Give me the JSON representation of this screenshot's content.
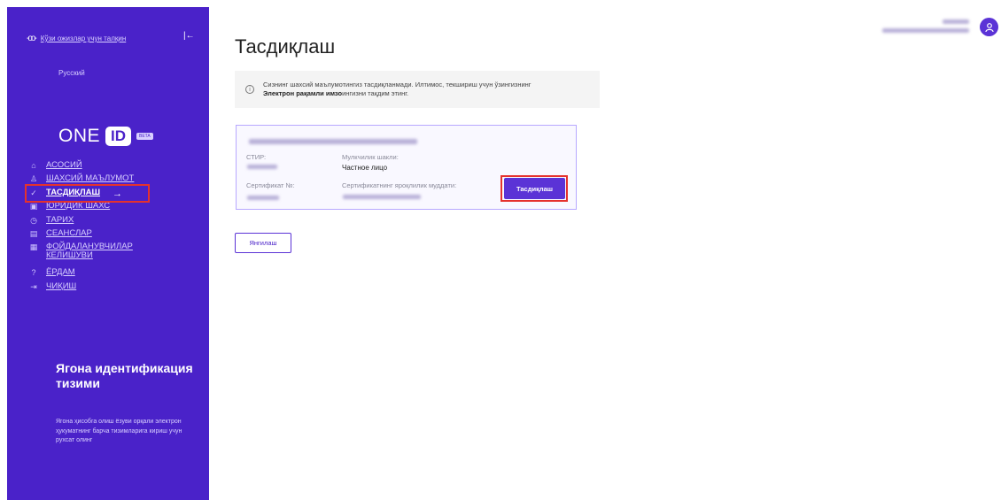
{
  "sidebar": {
    "low_vision_label": "Кўзи ожизлар учун талқин",
    "language": "Русский",
    "logo": {
      "one": "ONE",
      "id": "ID",
      "beta": "BETA"
    },
    "nav": [
      {
        "icon": "home-icon",
        "glyph": "⌂",
        "label": "АСОСИЙ"
      },
      {
        "icon": "person-icon",
        "glyph": "♙",
        "label": "ШАХСИЙ МАЪЛУМОТ"
      },
      {
        "icon": "check-circle-icon",
        "glyph": "✓",
        "label": "ТАСДИҚЛАШ",
        "active": true
      },
      {
        "icon": "briefcase-icon",
        "glyph": "▣",
        "label": "ЮРИДИК ШАХС"
      },
      {
        "icon": "clock-icon",
        "glyph": "◷",
        "label": "ТАРИХ"
      },
      {
        "icon": "sessions-icon",
        "glyph": "▤",
        "label": "СЕАНСЛАР"
      },
      {
        "icon": "agreement-icon",
        "glyph": "▦",
        "label": "ФОЙДАЛАНУВЧИЛАР КЕЛИШУВИ"
      },
      {
        "icon": "help-icon",
        "glyph": "?",
        "label": "ЁРДАМ"
      },
      {
        "icon": "logout-icon",
        "glyph": "⇥",
        "label": "ЧИҚИШ"
      }
    ],
    "active_arrow": "→",
    "promo": {
      "title": "Ягона идентификация тизими",
      "text": "Ягона ҳисобга олиш ёзуви орқали электрон ҳукуматнинг барча тизимларига кириш учун рухсат олинг"
    }
  },
  "main": {
    "title": "Тасдиқлаш",
    "alert": {
      "text": "Сизнинг шахсий маълумотингиз тасдиқланмади. Илтимос, текшириш учун ўзингизнинг ",
      "bold": "Электрон рақамли имзо",
      "suffix": "ингизни тақдим этинг."
    },
    "card": {
      "stir_label": "СТИР:",
      "ownership_label": "Мулкчилик шакли:",
      "ownership_value": "Частное лицо",
      "cert_label": "Сертификат №:",
      "validity_label": "Сертификатнинг яроқлилик муддати:",
      "confirm_button": "Тасдиқлаш"
    },
    "refresh_button": "Янгилаш"
  },
  "header": {
    "avatar_icon": "user-icon"
  }
}
